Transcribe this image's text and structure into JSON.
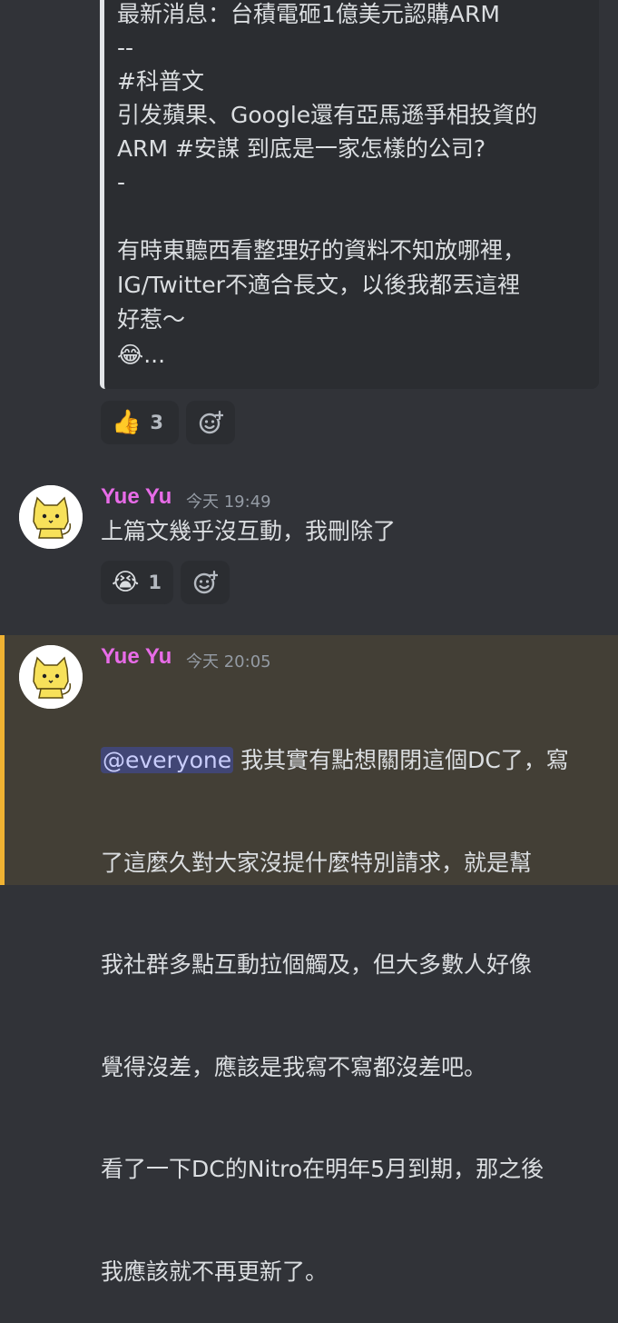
{
  "embed": {
    "lines": [
      "最新消息：台積電砸1億美元認購ARM",
      "--",
      "#科普文",
      "引发蘋果、Google還有亞馬遜爭相投資的",
      "ARM #安謀 到底是一家怎樣的公司?",
      "-",
      "",
      "有時東聽西看整理好的資料不知放哪裡，",
      "IG/Twitter不適合長文，以後我都丟這裡",
      "好惹～",
      "😂..."
    ]
  },
  "reactions_1": {
    "emoji": "👍",
    "count": "3"
  },
  "message_1": {
    "username": "Yue Yu",
    "timestamp": "今天 19:49",
    "text": "上篇文幾乎沒互動，我刪除了",
    "reaction": {
      "emoji": "😭",
      "count": "1"
    }
  },
  "message_2": {
    "username": "Yue Yu",
    "timestamp": "今天 20:05",
    "mention": "@everyone",
    "text_first": " 我其實有點想關閉這個DC了，寫",
    "lines": [
      "了這麼久對大家沒提什麼特別請求，就是幫",
      "我社群多點互動拉個觸及，但大多數人好像",
      "覺得沒差，應該是我寫不寫都沒差吧。",
      "看了一下DC的Nitro在明年5月到期，那之後",
      "我應該就不再更新了。"
    ]
  },
  "colors": {
    "background": "#313338",
    "username": "#e86ce8",
    "highlight": "#433f36",
    "highlight_bar": "#f0b232"
  }
}
